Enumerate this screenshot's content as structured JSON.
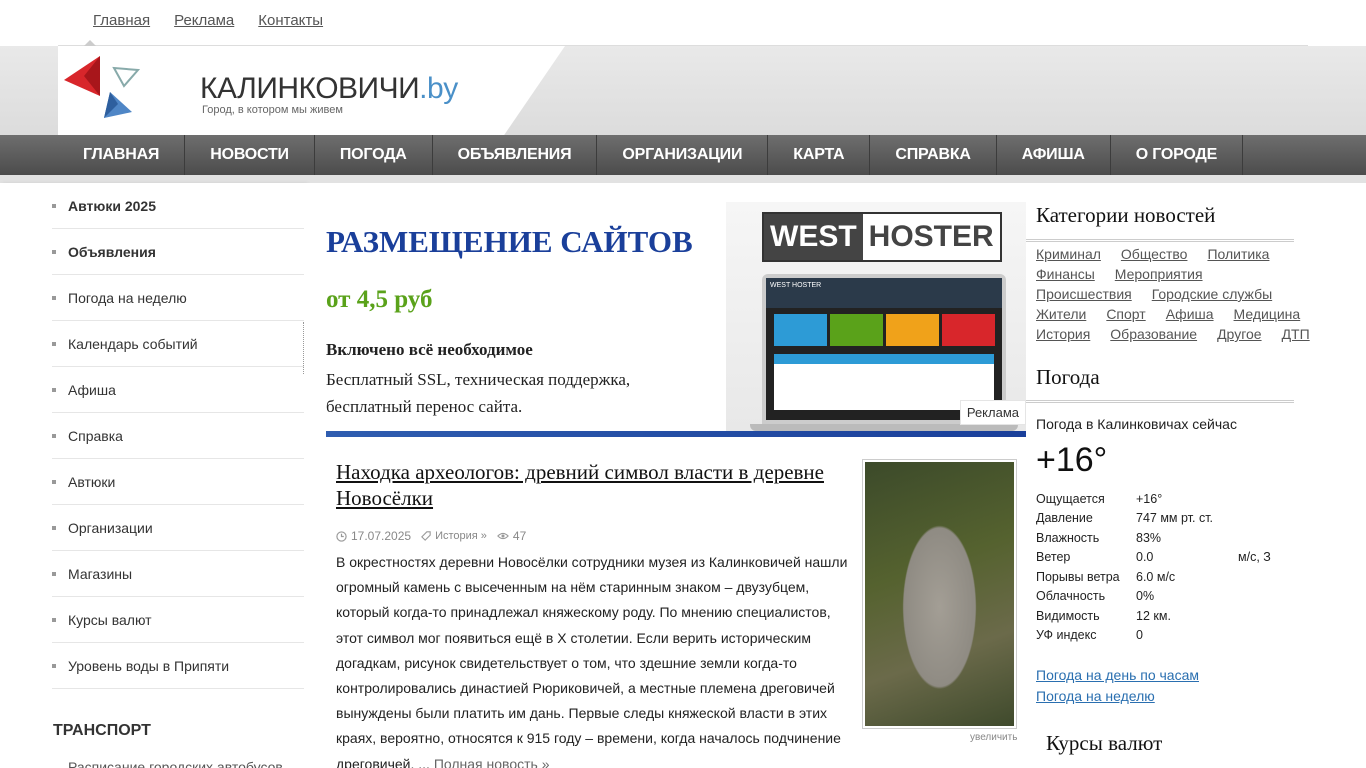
{
  "toplinks": [
    "Главная",
    "Реклама",
    "Контакты"
  ],
  "site": {
    "title_main": "КАЛИНКОВИЧИ",
    "title_tld": ".by",
    "slogan": "Город, в котором мы живем"
  },
  "nav": [
    "ГЛАВНАЯ",
    "НОВОСТИ",
    "ПОГОДА",
    "ОБЪЯВЛЕНИЯ",
    "ОРГАНИЗАЦИИ",
    "КАРТА",
    "СПРАВКА",
    "АФИША",
    "О ГОРОДЕ"
  ],
  "sidebar": {
    "items": [
      {
        "label": "Автюки 2025",
        "bold": true
      },
      {
        "label": "Объявления",
        "bold": true
      },
      {
        "label": "Погода на неделю",
        "bold": false
      },
      {
        "label": "Календарь событий",
        "bold": false
      },
      {
        "label": "Афиша",
        "bold": false
      },
      {
        "label": "Справка",
        "bold": false
      },
      {
        "label": "Автюки",
        "bold": false
      },
      {
        "label": "Организации",
        "bold": false
      },
      {
        "label": "Магазины",
        "bold": false
      },
      {
        "label": "Курсы валют",
        "bold": false
      },
      {
        "label": "Уровень воды в Припяти",
        "bold": false
      }
    ],
    "section_title": "ТРАНСПОРТ",
    "section_first": "Расписание городских автобусов"
  },
  "ad": {
    "headline": "РАЗМЕЩЕНИЕ САЙТОВ",
    "price": "от 4,5 руб",
    "bold_line": "Включено всё необходимое",
    "text": "Бесплатный SSL, техническая поддержка, бесплатный перенос сайта.",
    "brand_left": "WEST",
    "brand_right": "HOSTER",
    "screen_brand": "WEST HOSTER",
    "tag": "Реклама"
  },
  "article": {
    "title": "Находка археологов: древний символ власти в деревне Новосёлки",
    "date": "17.07.2025",
    "category": "История »",
    "views": "47",
    "body": "В окрестностях деревни Новосёлки сотрудники музея из Калинковичей нашли огромный камень с высеченным на нём старинным знаком – двузубцем, который когда-то принадлежал княжескому роду. По мнению специалистов, этот символ мог появиться ещё в X столетии. Если верить историческим догадкам, рисунок свидетельствует о том, что здешние земли когда-то контролировались династией Рюриковичей, а местные племена дреговичей вынуждены были платить им дань. Первые следы княжеской власти в этих краях, вероятно, относятся к 915 году – времени, когда началось подчинение дреговичей. ...",
    "more": "Полная новость »",
    "zoom": "увеличить"
  },
  "categories": {
    "title": "Категории новостей",
    "items": [
      "Криминал",
      "Общество",
      "Политика",
      "Финансы",
      "Мероприятия",
      "Происшествия",
      "Городские службы",
      "Жители",
      "Спорт",
      "Афиша",
      "Медицина",
      "История",
      "Образование",
      "Другое",
      "ДТП"
    ]
  },
  "weather": {
    "title": "Погода",
    "now_label": "Погода в Калинковичах сейчас",
    "temp": "+16°",
    "rows": [
      {
        "k": "Ощущается",
        "v": "+16°",
        "u": ""
      },
      {
        "k": "Давление",
        "v": "747 мм рт. ст.",
        "u": ""
      },
      {
        "k": "Влажность",
        "v": "83%",
        "u": ""
      },
      {
        "k": "Ветер",
        "v": "0.0",
        "u": "м/с, З"
      },
      {
        "k": "Порывы ветра",
        "v": "6.0 м/с",
        "u": ""
      },
      {
        "k": "Облачность",
        "v": "0%",
        "u": ""
      },
      {
        "k": "Видимость",
        "v": "12 км.",
        "u": ""
      },
      {
        "k": "УФ индекс",
        "v": "0",
        "u": ""
      }
    ],
    "link_hourly": "Погода на день по часам",
    "link_week": "Погода на неделю"
  },
  "currency_title": "Курсы валют",
  "colors": {
    "accent_blue": "#1a3f9a",
    "accent_green": "#5aa21a",
    "link": "#2a6fb0",
    "nav_bg": "#5a5a5a"
  }
}
